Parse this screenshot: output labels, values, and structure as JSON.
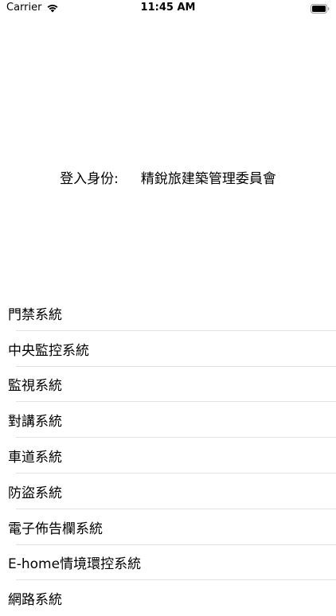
{
  "status_bar": {
    "carrier": "Carrier",
    "time": "11:45 AM"
  },
  "identity": {
    "label": "登入身份:",
    "value": "精銳旅建築管理委員會"
  },
  "menu": {
    "items": [
      {
        "label": "門禁系統"
      },
      {
        "label": "中央監控系統"
      },
      {
        "label": "監視系統"
      },
      {
        "label": "對講系統"
      },
      {
        "label": "車道系統"
      },
      {
        "label": "防盜系統"
      },
      {
        "label": "電子佈告欄系統"
      },
      {
        "label": "E-home情境環控系統"
      },
      {
        "label": "網路系統"
      }
    ]
  },
  "icons": {
    "wifi": "wifi-icon",
    "battery": "battery-icon"
  },
  "colors": {
    "background": "#ffffff",
    "text": "#000000",
    "separator": "#e3e3e6"
  }
}
